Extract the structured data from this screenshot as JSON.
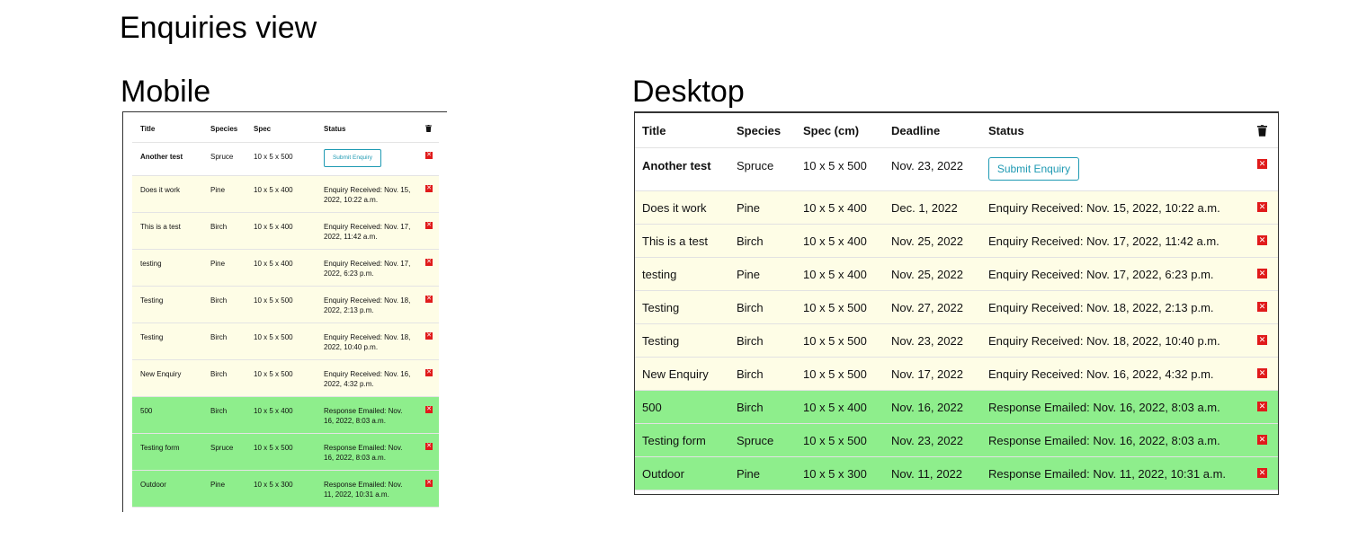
{
  "page_title": "Enquiries view",
  "mobile": {
    "label": "Mobile",
    "headers": {
      "title": "Title",
      "species": "Species",
      "spec": "Spec",
      "status": "Status"
    },
    "first_row": {
      "title": "Another test",
      "species": "Spruce",
      "spec": "10 x 5 x 500",
      "button": "Submit Enquiry"
    },
    "rows": [
      {
        "title": "Does it work",
        "species": "Pine",
        "spec": "10 x 5 x 400",
        "status": "Enquiry Received: Nov. 15, 2022, 10:22 a.m.",
        "state": "received"
      },
      {
        "title": "This is a test",
        "species": "Birch",
        "spec": "10 x 5 x 400",
        "status": "Enquiry Received: Nov. 17, 2022, 11:42 a.m.",
        "state": "received"
      },
      {
        "title": "testing",
        "species": "Pine",
        "spec": "10 x 5 x 400",
        "status": "Enquiry Received: Nov. 17, 2022, 6:23 p.m.",
        "state": "received"
      },
      {
        "title": "Testing",
        "species": "Birch",
        "spec": "10 x 5 x 500",
        "status": "Enquiry Received: Nov. 18, 2022, 2:13 p.m.",
        "state": "received"
      },
      {
        "title": "Testing",
        "species": "Birch",
        "spec": "10 x 5 x 500",
        "status": "Enquiry Received: Nov. 18, 2022, 10:40 p.m.",
        "state": "received"
      },
      {
        "title": "New Enquiry",
        "species": "Birch",
        "spec": "10 x 5 x 500",
        "status": "Enquiry Received: Nov. 16, 2022, 4:32 p.m.",
        "state": "received"
      },
      {
        "title": "500",
        "species": "Birch",
        "spec": "10 x 5 x 400",
        "status": "Response Emailed: Nov. 16, 2022, 8:03 a.m.",
        "state": "emailed"
      },
      {
        "title": "Testing form",
        "species": "Spruce",
        "spec": "10 x 5 x 500",
        "status": "Response Emailed: Nov. 16, 2022, 8:03 a.m.",
        "state": "emailed"
      },
      {
        "title": "Outdoor",
        "species": "Pine",
        "spec": "10 x 5 x 300",
        "status": "Response Emailed: Nov. 11, 2022, 10:31 a.m.",
        "state": "emailed"
      }
    ]
  },
  "desktop": {
    "label": "Desktop",
    "headers": {
      "title": "Title",
      "species": "Species",
      "spec": "Spec (cm)",
      "deadline": "Deadline",
      "status": "Status"
    },
    "first_row": {
      "title": "Another test",
      "species": "Spruce",
      "spec": "10 x 5 x 500",
      "deadline": "Nov. 23, 2022",
      "button": "Submit Enquiry"
    },
    "rows": [
      {
        "title": "Does it work",
        "species": "Pine",
        "spec": "10 x 5 x 400",
        "deadline": "Dec. 1, 2022",
        "status": "Enquiry Received: Nov. 15, 2022, 10:22 a.m.",
        "state": "received"
      },
      {
        "title": "This is a test",
        "species": "Birch",
        "spec": "10 x 5 x 400",
        "deadline": "Nov. 25, 2022",
        "status": "Enquiry Received: Nov. 17, 2022, 11:42 a.m.",
        "state": "received"
      },
      {
        "title": "testing",
        "species": "Pine",
        "spec": "10 x 5 x 400",
        "deadline": "Nov. 25, 2022",
        "status": "Enquiry Received: Nov. 17, 2022, 6:23 p.m.",
        "state": "received"
      },
      {
        "title": "Testing",
        "species": "Birch",
        "spec": "10 x 5 x 500",
        "deadline": "Nov. 27, 2022",
        "status": "Enquiry Received: Nov. 18, 2022, 2:13 p.m.",
        "state": "received"
      },
      {
        "title": "Testing",
        "species": "Birch",
        "spec": "10 x 5 x 500",
        "deadline": "Nov. 23, 2022",
        "status": "Enquiry Received: Nov. 18, 2022, 10:40 p.m.",
        "state": "received"
      },
      {
        "title": "New Enquiry",
        "species": "Birch",
        "spec": "10 x 5 x 500",
        "deadline": "Nov. 17, 2022",
        "status": "Enquiry Received: Nov. 16, 2022, 4:32 p.m.",
        "state": "received"
      },
      {
        "title": "500",
        "species": "Birch",
        "spec": "10 x 5 x 400",
        "deadline": "Nov. 16, 2022",
        "status": "Response Emailed: Nov. 16, 2022, 8:03 a.m.",
        "state": "emailed"
      },
      {
        "title": "Testing form",
        "species": "Spruce",
        "spec": "10 x 5 x 500",
        "deadline": "Nov. 23, 2022",
        "status": "Response Emailed: Nov. 16, 2022, 8:03 a.m.",
        "state": "emailed"
      },
      {
        "title": "Outdoor",
        "species": "Pine",
        "spec": "10 x 5 x 300",
        "deadline": "Nov. 11, 2022",
        "status": "Response Emailed: Nov. 11, 2022, 10:31 a.m.",
        "state": "emailed"
      }
    ]
  },
  "icons": {
    "delete": "delete-x-icon",
    "header": "trash-icon"
  },
  "colors": {
    "received": "#fefde6",
    "emailed": "#8eee8c",
    "accent": "#1f9ab3",
    "delete": "#e01b1b"
  }
}
